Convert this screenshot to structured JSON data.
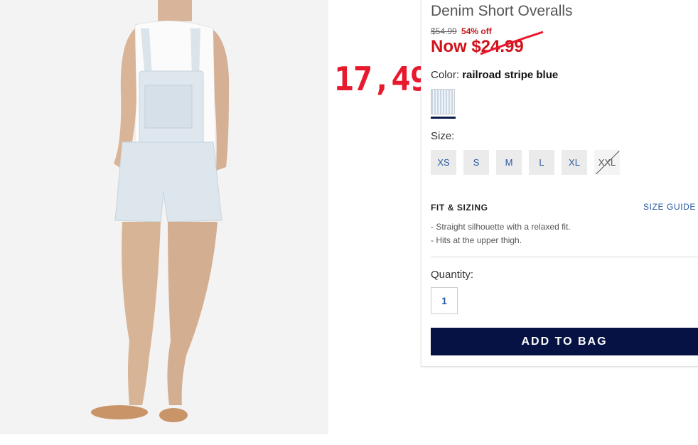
{
  "product": {
    "title": "Denim Short Overalls",
    "original_price": "$54.99",
    "discount": "54% off",
    "now_price": "Now $24.99",
    "annotation_price": "17,49"
  },
  "color": {
    "label": "Color:",
    "value": "railroad stripe blue"
  },
  "size": {
    "label": "Size:",
    "options": [
      {
        "label": "XS",
        "available": true
      },
      {
        "label": "S",
        "available": true
      },
      {
        "label": "M",
        "available": true
      },
      {
        "label": "L",
        "available": true
      },
      {
        "label": "XL",
        "available": true
      },
      {
        "label": "XXL",
        "available": false
      }
    ]
  },
  "fit": {
    "title": "FIT & SIZING",
    "size_guide": "SIZE GUIDE",
    "items": [
      "- Straight silhouette with a relaxed fit.",
      "- Hits at the upper thigh."
    ]
  },
  "quantity": {
    "label": "Quantity:",
    "value": "1"
  },
  "add_to_bag": "ADD TO BAG",
  "colors": {
    "accent": "#061244",
    "sale": "#d0121b",
    "link": "#2b5aa0"
  }
}
